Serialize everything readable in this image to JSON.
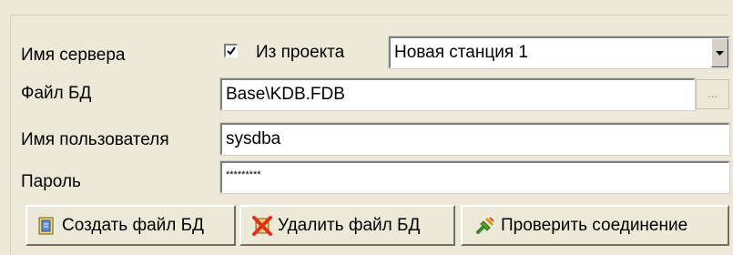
{
  "form": {
    "server_label": "Имя сервера",
    "from_project_label": "Из проекта",
    "from_project_checked": true,
    "server_value": "Новая станция 1",
    "db_file_label": "Файл БД",
    "db_file_value": "Base\\KDB.FDB",
    "browse_label": "...",
    "user_label": "Имя пользователя",
    "user_value": "sysdba",
    "password_label": "Пароль",
    "password_value": "*********"
  },
  "buttons": {
    "create": "Создать файл БД",
    "delete": "Удалить файл БД",
    "test": "Проверить соединение"
  },
  "icons": {
    "create": "db-file-icon",
    "delete": "delete-x-icon",
    "test": "plug-connection-icon"
  }
}
